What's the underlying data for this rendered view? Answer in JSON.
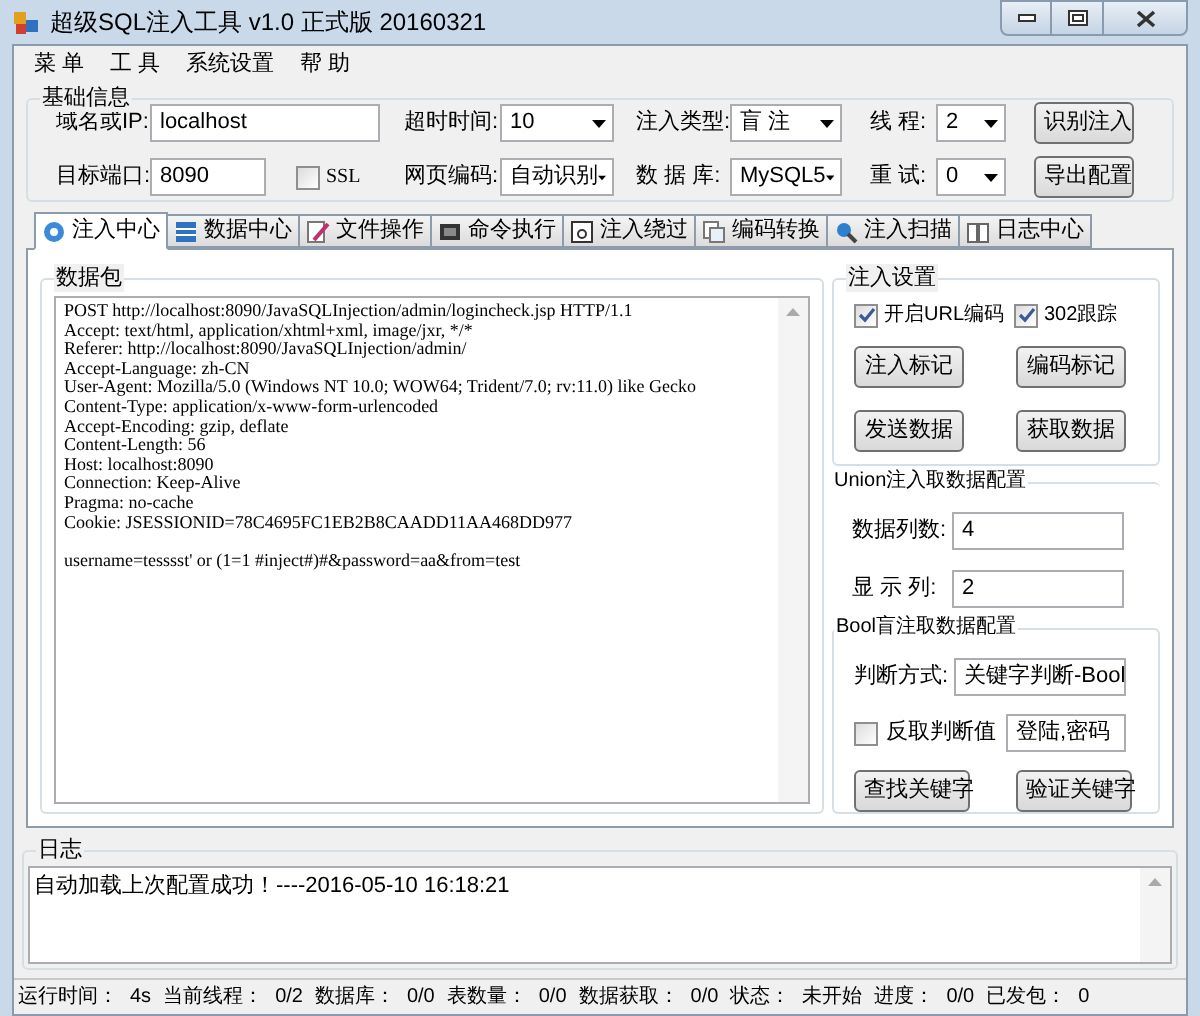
{
  "window": {
    "title": "超级SQL注入工具 v1.0 正式版 20160321"
  },
  "menu": [
    "菜 单",
    "工 具",
    "系统设置",
    "帮 助"
  ],
  "basic_info": {
    "title": "基础信息",
    "rows": [
      [
        {
          "kind": "label",
          "text": "域名或IP:"
        },
        {
          "kind": "text",
          "value": "localhost"
        },
        "",
        {
          "kind": "label",
          "text": "超时时间:"
        },
        {
          "kind": "select",
          "value": "10"
        },
        {
          "kind": "label",
          "text": "注入类型:"
        },
        {
          "kind": "select",
          "value": "盲 注"
        },
        {
          "kind": "label",
          "text": "线 程:"
        },
        {
          "kind": "select",
          "value": "2"
        },
        {
          "kind": "button",
          "label": "识别注入"
        }
      ],
      [
        {
          "kind": "label",
          "text": "目标端口:"
        },
        {
          "kind": "text",
          "value": "8090"
        },
        {
          "kind": "checkbox",
          "label": "SSL",
          "checked": false
        },
        {
          "kind": "label",
          "text": "网页编码:"
        },
        {
          "kind": "select",
          "value": "自动识别"
        },
        {
          "kind": "label",
          "text": "数 据 库:"
        },
        {
          "kind": "select",
          "value": "MySQL5"
        },
        {
          "kind": "label",
          "text": "重 试:"
        },
        {
          "kind": "select",
          "value": "0"
        },
        {
          "kind": "button",
          "label": "导出配置"
        }
      ]
    ]
  },
  "tabs": [
    {
      "label": "注入中心",
      "selected": true
    },
    {
      "label": "数据中心",
      "selected": false
    },
    {
      "label": "文件操作",
      "selected": false
    },
    {
      "label": "命令执行",
      "selected": false
    },
    {
      "label": "注入绕过",
      "selected": false
    },
    {
      "label": "编码转换",
      "selected": false
    },
    {
      "label": "注入扫描",
      "selected": false
    },
    {
      "label": "日志中心",
      "selected": false
    }
  ],
  "packet": {
    "title": "数据包",
    "text": "POST http://localhost:8090/JavaSQLInjection/admin/logincheck.jsp HTTP/1.1\nAccept: text/html, application/xhtml+xml, image/jxr, */*\nReferer: http://localhost:8090/JavaSQLInjection/admin/\nAccept-Language: zh-CN\nUser-Agent: Mozilla/5.0 (Windows NT 10.0; WOW64; Trident/7.0; rv:11.0) like Gecko\nContent-Type: application/x-www-form-urlencoded\nAccept-Encoding: gzip, deflate\nContent-Length: 56\nHost: localhost:8090\nConnection: Keep-Alive\nPragma: no-cache\nCookie: JSESSIONID=78C4695FC1EB2B8CAADD11AA468DD977\n\nusername=tesssst' or (1=1 #inject#)#&password=aa&from=test"
  },
  "inject_settings": {
    "title": "注入设置",
    "checkboxes": [
      {
        "label": "开启URL编码",
        "checked": true
      },
      {
        "label": "302跟踪",
        "checked": true
      }
    ],
    "buttons": [
      "注入标记",
      "编码标记",
      "发送数据",
      "获取数据"
    ]
  },
  "union_config": {
    "title": "Union注入取数据配置",
    "fields": [
      {
        "label": "数据列数:",
        "value": "4"
      },
      {
        "label": "显 示 列:",
        "value": "2"
      }
    ]
  },
  "bool_config": {
    "title": "Bool盲注取数据配置",
    "method_label": "判断方式:",
    "method": "关键字判断-Bool",
    "invert": {
      "label": "反取判断值",
      "checked": false
    },
    "keywords": "登陆,密码",
    "buttons": [
      "查找关键字",
      "验证关键字"
    ]
  },
  "log": {
    "title": "日志",
    "text": "自动加载上次配置成功！----2016-05-10 16:18:21"
  },
  "status_bar": [
    {
      "label": "运行时间：",
      "value": "4s"
    },
    {
      "label": "当前线程：",
      "value": "0/2"
    },
    {
      "label": "数据库：",
      "value": "0/0"
    },
    {
      "label": "表数量：",
      "value": "0/0"
    },
    {
      "label": "数据获取：",
      "value": "0/0"
    },
    {
      "label": "状态：",
      "value": "未开始"
    },
    {
      "label": "进度：",
      "value": "0/0"
    },
    {
      "label": "已发包：",
      "value": "0"
    }
  ]
}
